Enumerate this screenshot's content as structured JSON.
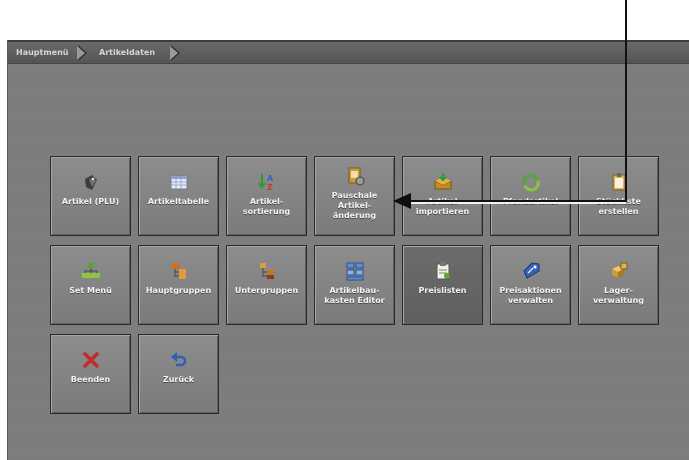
{
  "breadcrumb": {
    "items": [
      "Hauptmenü",
      "Artikeldaten"
    ]
  },
  "tiles": [
    {
      "label": "Artikel (PLU)",
      "icon": "tag-icon"
    },
    {
      "label": "Artikeltabelle",
      "icon": "table-icon"
    },
    {
      "label": "Artikel-\nsortierung",
      "icon": "sort-az-icon"
    },
    {
      "label": "Pauschale\nArtikel-\nänderung",
      "icon": "edit-items-icon"
    },
    {
      "label": "Artikel\nimportieren",
      "icon": "import-icon"
    },
    {
      "label": "Pfandartikel",
      "icon": "recycle-icon"
    },
    {
      "label": "Stückliste\nerstellen",
      "icon": "clipboard-icon"
    },
    {
      "label": "Set Menü",
      "icon": "hierarchy-icon"
    },
    {
      "label": "Hauptgruppen",
      "icon": "main-groups-icon"
    },
    {
      "label": "Untergruppen",
      "icon": "sub-groups-icon"
    },
    {
      "label": "Artikelbau-\nkasten Editor",
      "icon": "building-blocks-icon"
    },
    {
      "label": "Preislisten",
      "icon": "price-list-icon"
    },
    {
      "label": "Preisaktionen\nverwalten",
      "icon": "price-tag-icon"
    },
    {
      "label": "Lager-\nverwaltung",
      "icon": "boxes-icon"
    },
    {
      "label": "Beenden",
      "icon": "close-x-icon"
    },
    {
      "label": "Zurück",
      "icon": "back-arrow-icon"
    }
  ],
  "colors": {
    "tile_text": "#f2f2f2",
    "callout": "#111111"
  }
}
